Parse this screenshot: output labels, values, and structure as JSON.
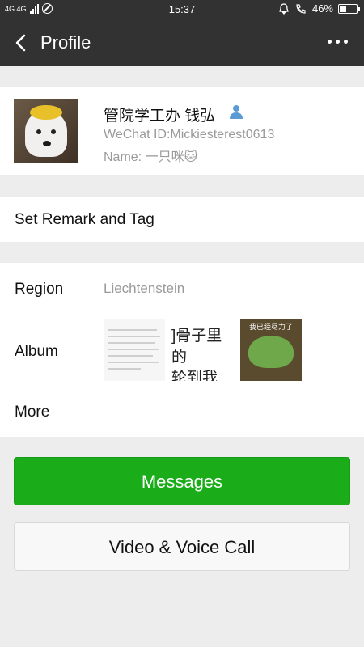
{
  "status_bar": {
    "network": "4G 4G",
    "time": "15:37",
    "battery": "46%",
    "battery_level": 0.46
  },
  "nav": {
    "title": "Profile",
    "back_icon": "chevron-left-icon",
    "more_icon": "more-dots-icon"
  },
  "profile": {
    "name": "管院学工办 钱弘",
    "wechat_id": "WeChat ID:Mickiesterest0613",
    "alias": "Name: 一只咪🐱"
  },
  "actions": {
    "remark_label": "Set Remark and Tag"
  },
  "info": {
    "region_label": "Region",
    "region_value": "Liechtenstein",
    "album_label": "Album",
    "album_snippet_line1": "]骨子里的",
    "album_snippet_line2": "轮到我",
    "album_image_caption": "我已经尽力了",
    "more_label": "More"
  },
  "buttons": {
    "messages": "Messages",
    "call": "Video & Voice Call"
  },
  "colors": {
    "header": "#323232",
    "primary": "#1aad19",
    "background": "#ededed"
  }
}
